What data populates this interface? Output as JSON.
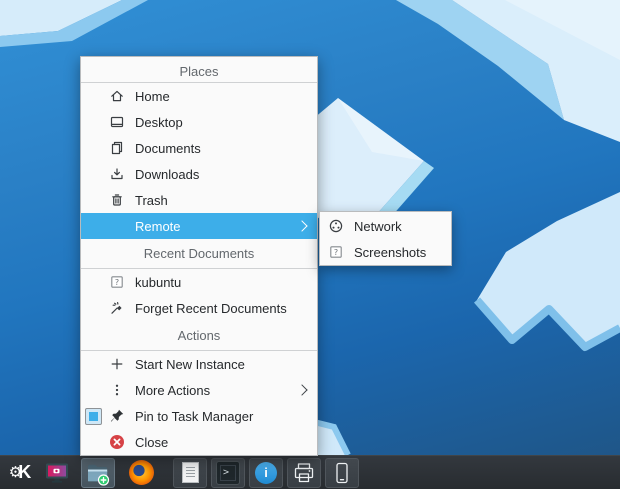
{
  "colors": {
    "accent": "#3daee9",
    "menu_background": "#fafafa",
    "panel_background": "#2e3338",
    "close_red": "#d64246",
    "wallpaper_blue": "#2176bf"
  },
  "context_menu": {
    "sections": [
      {
        "header": "Places",
        "items": [
          {
            "label": "Home",
            "icon": "home-icon"
          },
          {
            "label": "Desktop",
            "icon": "desktop-icon"
          },
          {
            "label": "Documents",
            "icon": "documents-icon"
          },
          {
            "label": "Downloads",
            "icon": "downloads-icon"
          },
          {
            "label": "Trash",
            "icon": "trash-icon"
          },
          {
            "label": "Remote",
            "icon": "none",
            "highlighted": true,
            "has_submenu": true
          }
        ]
      },
      {
        "header": "Recent Documents",
        "items": [
          {
            "label": "kubuntu",
            "icon": "unknown-file-icon"
          },
          {
            "label": "Forget Recent Documents",
            "icon": "clear-history-icon"
          }
        ]
      },
      {
        "header": "Actions",
        "items": [
          {
            "label": "Start New Instance",
            "icon": "plus-icon"
          },
          {
            "label": "More Actions",
            "icon": "ellipsis-icon",
            "has_submenu": true
          },
          {
            "label": "Pin to Task Manager",
            "icon": "pin-icon",
            "checkbox": true
          },
          {
            "label": "Close",
            "icon": "close-icon"
          }
        ]
      }
    ]
  },
  "submenu": {
    "items": [
      {
        "label": "Network",
        "icon": "network-icon"
      },
      {
        "label": "Screenshots",
        "icon": "unknown-file-icon"
      }
    ]
  },
  "taskbar": {
    "items": [
      "kde-menu-launcher",
      "display-app",
      "file-manager-dolphin",
      "firefox",
      "text-editor",
      "terminal",
      "info",
      "printer",
      "phone"
    ]
  }
}
